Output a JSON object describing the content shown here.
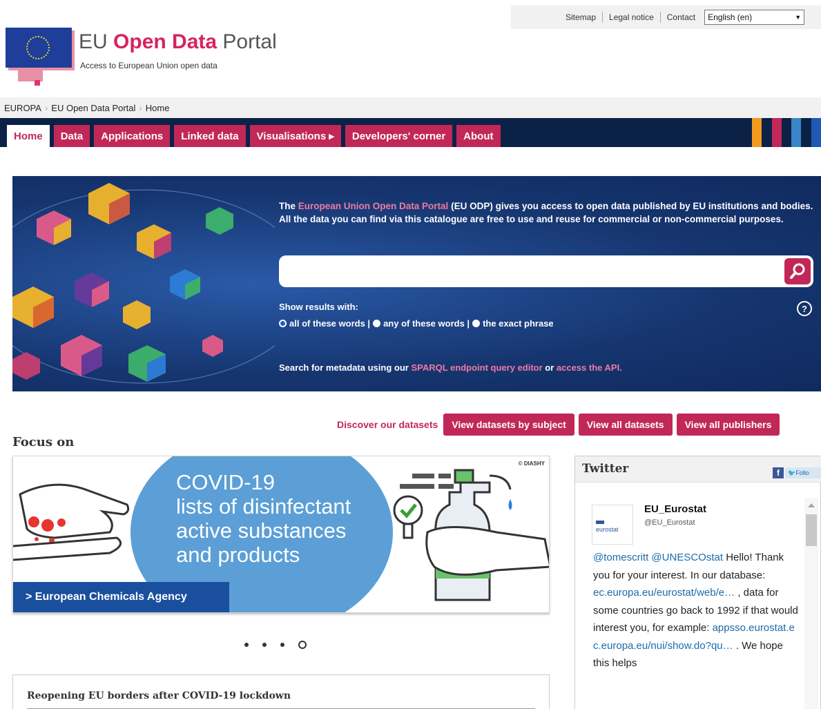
{
  "utility": {
    "links": [
      "Sitemap",
      "Legal notice",
      "Contact"
    ],
    "language": "English (en)"
  },
  "logo": {
    "title_part1": "EU",
    "title_accent": "Open Data",
    "title_part2": "Portal",
    "subtitle": "Access to European Union open data"
  },
  "breadcrumb": [
    "EUROPA",
    "EU Open Data Portal",
    "Home"
  ],
  "nav": {
    "tabs": [
      "Home",
      "Data",
      "Applications",
      "Linked data",
      "Visualisations ▸",
      "Developers' corner",
      "About"
    ]
  },
  "hero": {
    "intro_pre": "The",
    "intro_link": "European Union Open Data Portal",
    "intro_post": "(EU ODP) gives you access to open data published by EU institutions and bodies. All the data you can find via this catalogue are free to use and reuse for commercial or non-commercial purposes.",
    "search_value": "",
    "show_results_label": "Show results with:",
    "radio_options": [
      "all of these words |",
      "any of these words |",
      "the exact phrase"
    ],
    "meta_pre": "Search for metadata using our",
    "meta_link1": "SPARQL endpoint query editor",
    "meta_mid": "or",
    "meta_link2": "access the API."
  },
  "discover": {
    "label": "Discover our datasets",
    "buttons": [
      "View datasets by subject",
      "View all datasets",
      "View all publishers"
    ]
  },
  "focus": {
    "title": "Focus on",
    "banner_lines": [
      "COVID-19",
      "lists of disinfectant",
      "active substances",
      "and products"
    ],
    "banner_copyright": "© DIASHY",
    "banner_link": "> European Chemicals Agency",
    "news_title": "Reopening EU borders after COVID-19 lockdown"
  },
  "twitter": {
    "title": "Twitter",
    "follow": "Follo",
    "avatar_text": "eurostat",
    "name": "EU_Eurostat",
    "handle": "@EU_Eurostat",
    "mention1": "@tomescritt",
    "mention2": "@UNESCOstat",
    "text1": "Hello! Thank you for your interest. In our database:",
    "link1": "ec.europa.eu/eurostat/web/e…",
    "text2": ", data for some countries go back to 1992 if that would interest you, for example:",
    "link2": "appsso.eurostat.ec.europa.eu/nui/show.do?qu…",
    "text3": ". We hope this helps"
  },
  "colors": {
    "brand": "#c12858",
    "nav_bg": "#0b2246",
    "hero_bg": "#16356f",
    "link": "#1c6aa8"
  }
}
